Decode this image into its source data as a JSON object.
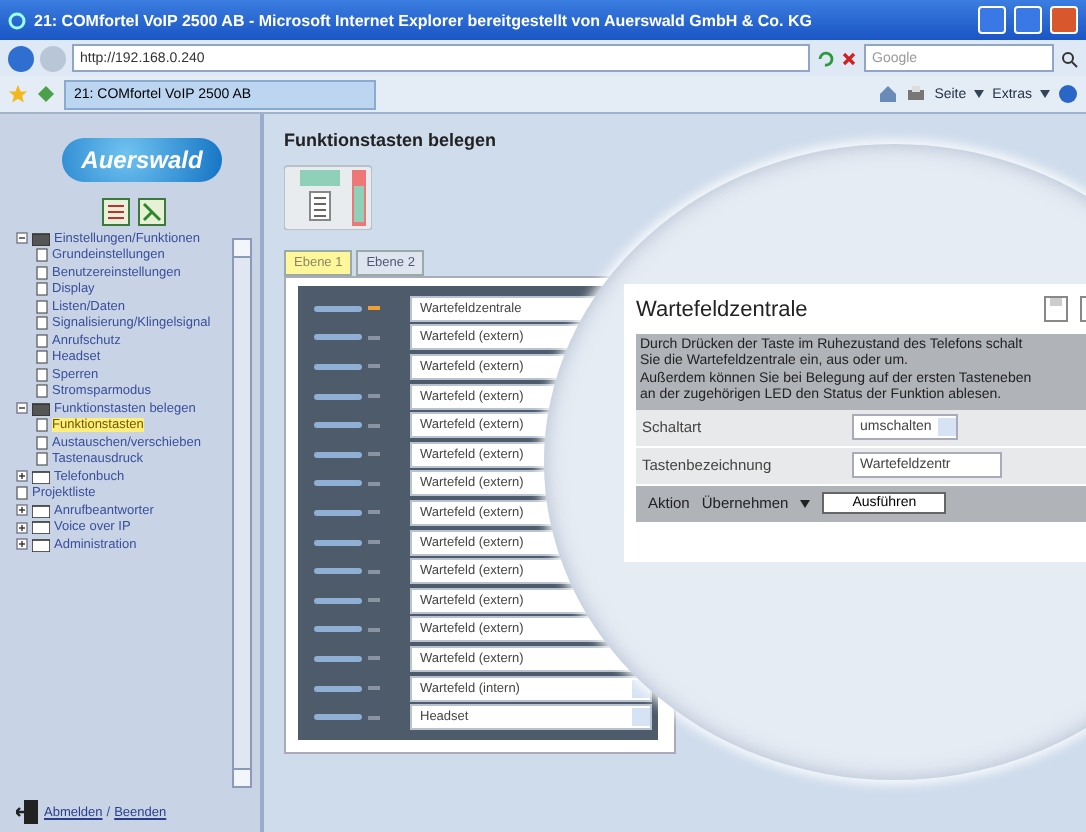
{
  "window": {
    "title": "21: COMfortel VoIP 2500 AB - Microsoft Internet Explorer bereitgestellt von Auerswald GmbH & Co. KG"
  },
  "browser": {
    "address": "http://192.168.0.240",
    "search_placeholder": "Google",
    "tab": "21: COMfortel VoIP 2500 AB",
    "toolbar": [
      "Seite",
      "Extras"
    ]
  },
  "sidebar": {
    "logo": "Auerswald",
    "tree": [
      {
        "label": "Einstellungen/Funktionen",
        "kind": "folder",
        "expanded": true,
        "selected": false,
        "children": [
          {
            "label": "Grundeinstellungen",
            "selected": false
          },
          {
            "label": "Benutzereinstellungen",
            "selected": false
          },
          {
            "label": "Display",
            "selected": false
          },
          {
            "label": "Listen/Daten",
            "selected": false
          },
          {
            "label": "Signalisierung/Klingelsignal",
            "selected": false
          },
          {
            "label": "Anrufschutz",
            "selected": false
          },
          {
            "label": "Headset",
            "selected": false
          },
          {
            "label": "Sperren",
            "selected": false
          },
          {
            "label": "Stromsparmodus",
            "selected": false
          }
        ]
      },
      {
        "label": "Funktionstasten belegen",
        "kind": "folder",
        "expanded": true,
        "selected": false,
        "children": [
          {
            "label": "Funktionstasten",
            "selected": true
          },
          {
            "label": "Austauschen/verschieben",
            "selected": false
          },
          {
            "label": "Tastenausdruck",
            "selected": false
          }
        ]
      },
      {
        "label": "Telefonbuch",
        "kind": "folder",
        "expanded": false,
        "selected": false
      },
      {
        "label": "Projektliste",
        "kind": "page",
        "selected": false
      },
      {
        "label": "Anrufbeantworter",
        "kind": "folder",
        "expanded": false,
        "selected": false
      },
      {
        "label": "Voice over IP",
        "kind": "folder",
        "expanded": false,
        "selected": false
      },
      {
        "label": "Administration",
        "kind": "folder",
        "expanded": false,
        "selected": false
      }
    ],
    "footer": {
      "links": [
        "Abmelden",
        "Beenden"
      ],
      "separator": "/"
    }
  },
  "main": {
    "heading": "Funktionstasten belegen",
    "tabs": [
      {
        "label": "Ebene 1",
        "selected": true
      },
      {
        "label": "Ebene 2",
        "selected": false
      }
    ],
    "keys": [
      {
        "function": "Wartefeldzentrale",
        "led_on": true
      },
      {
        "function": "Wartefeld (extern)",
        "led_on": false
      },
      {
        "function": "Wartefeld (extern)",
        "led_on": false
      },
      {
        "function": "Wartefeld (extern)",
        "led_on": false
      },
      {
        "function": "Wartefeld (extern)",
        "led_on": false
      },
      {
        "function": "Wartefeld (extern)",
        "led_on": false
      },
      {
        "function": "Wartefeld (extern)",
        "led_on": false
      },
      {
        "function": "Wartefeld (extern)",
        "led_on": false
      },
      {
        "function": "Wartefeld (extern)",
        "led_on": false
      },
      {
        "function": "Wartefeld (extern)",
        "led_on": false
      },
      {
        "function": "Wartefeld (extern)",
        "led_on": false
      },
      {
        "function": "Wartefeld (extern)",
        "led_on": false
      },
      {
        "function": "Wartefeld (extern)",
        "led_on": false
      },
      {
        "function": "Wartefeld (intern)",
        "led_on": false
      },
      {
        "function": "Headset",
        "led_on": false
      }
    ]
  },
  "detail": {
    "title": "Wartefeldzentrale",
    "description": "Durch Drücken der Taste im Ruhezustand des Telefons schalt\nSie die Wartefeldzentrale ein, aus oder um.\nAußerdem können Sie bei Belegung auf der ersten Tasteneben\nan der zugehörigen LED den Status der Funktion ablesen.",
    "fields": [
      {
        "label": "Schaltart",
        "kind": "select",
        "value": "umschalten"
      },
      {
        "label": "Tastenbezeichnung",
        "kind": "text",
        "value": "Wartefeldzentr"
      }
    ],
    "action": {
      "label": "Aktion",
      "select": "Übernehmen",
      "button": "Ausführen"
    }
  }
}
